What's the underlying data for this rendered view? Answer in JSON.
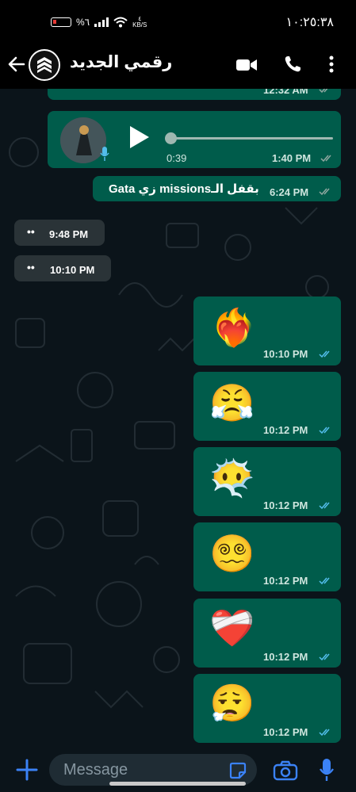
{
  "status_bar": {
    "clock": "١٠:٢٥:٣٨",
    "battery": "%٦",
    "speed_unit": "KB/S",
    "speed_value": "٤"
  },
  "header": {
    "title": "رقمي الجديد"
  },
  "voice_message": {
    "duration": "0:39",
    "time": "1:40 PM"
  },
  "messages": [
    {
      "id": "m0",
      "direction": "out",
      "time": "12:32 AM",
      "read": false
    },
    {
      "id": "m2",
      "direction": "out",
      "text": "بقفل الـmissions زي Gata",
      "time": "6:24 PM",
      "read": false
    },
    {
      "id": "m3",
      "direction": "in",
      "text": "••",
      "time": "9:48 PM"
    },
    {
      "id": "m4",
      "direction": "in",
      "text": "••",
      "time": "10:10 PM"
    },
    {
      "id": "m5",
      "direction": "out",
      "emoji": "❤️‍🔥",
      "time": "10:10 PM",
      "read": true
    },
    {
      "id": "m6",
      "direction": "out",
      "emoji": "😤",
      "time": "10:12 PM",
      "read": true
    },
    {
      "id": "m7",
      "direction": "out",
      "emoji": "😶‍🌫️",
      "time": "10:12 PM",
      "read": true
    },
    {
      "id": "m8",
      "direction": "out",
      "emoji": "😵‍💫",
      "time": "10:12 PM",
      "read": true
    },
    {
      "id": "m9",
      "direction": "out",
      "emoji": "❤️‍🩹",
      "time": "10:12 PM",
      "read": true
    },
    {
      "id": "m10",
      "direction": "out",
      "emoji": "😮‍💨",
      "time": "10:12 PM",
      "read": true
    }
  ],
  "input": {
    "placeholder": "Message"
  },
  "colors": {
    "outgoing_bubble": "#005c4b",
    "incoming_bubble": "#2a3337",
    "read_tick": "#53bdeb",
    "unread_tick": "#8fa7a0",
    "accent_blue": "#3b82f6"
  }
}
